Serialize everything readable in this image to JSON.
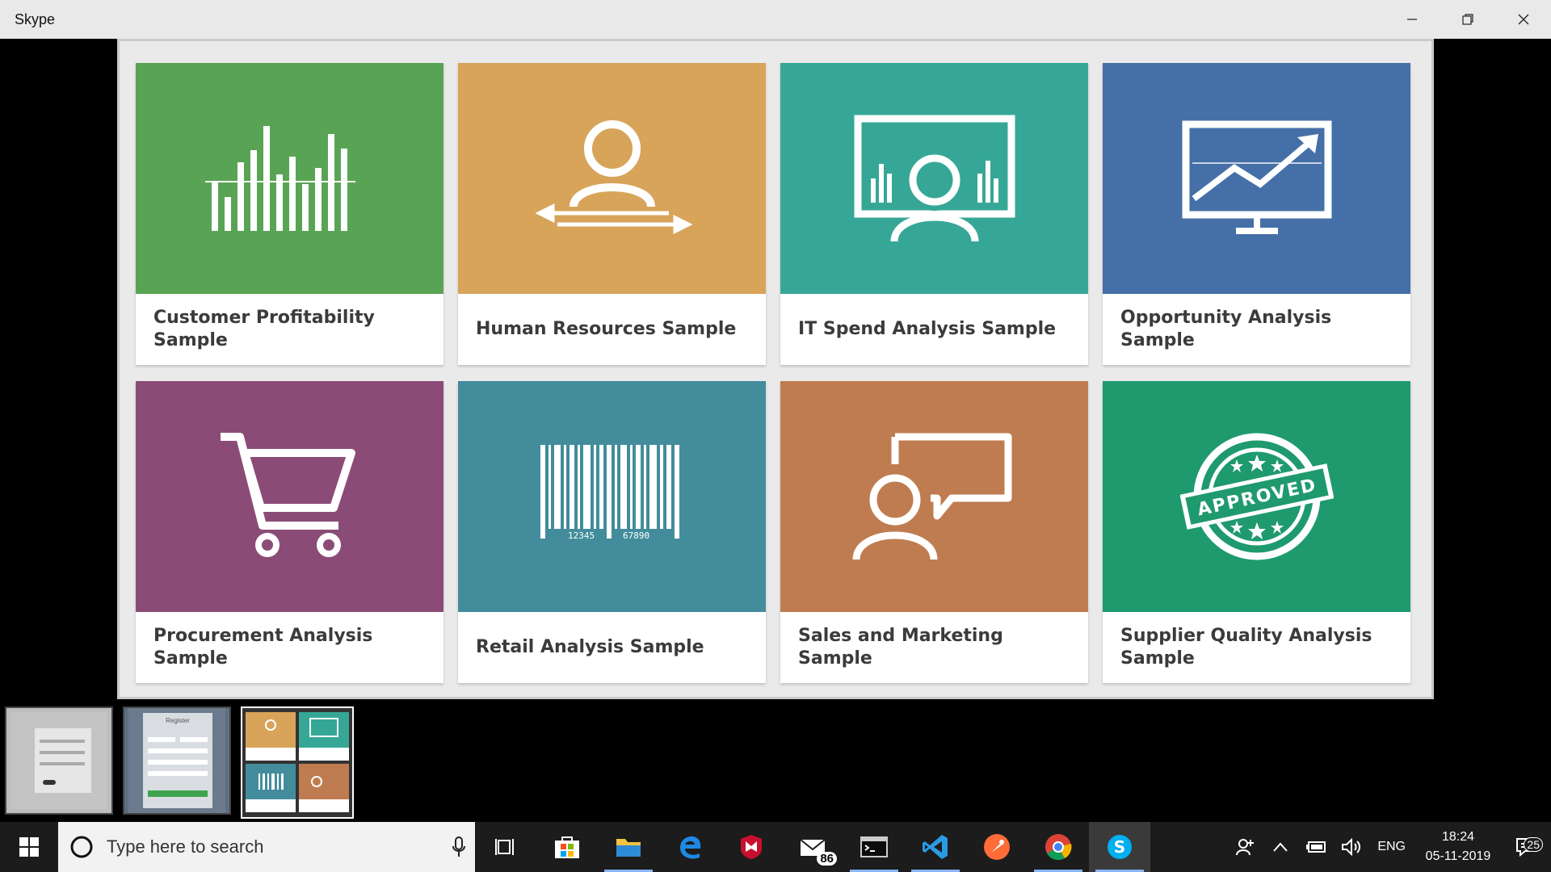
{
  "window": {
    "title": "Skype"
  },
  "tiles": [
    {
      "label_line1": "Customer Profitability",
      "label_line2": "Sample",
      "color": "#59a454",
      "icon": "bar-chart-icon"
    },
    {
      "label_line1": "Human Resources Sample",
      "label_line2": "",
      "color": "#d7a45a",
      "icon": "person-arrows-icon"
    },
    {
      "label_line1": "IT Spend Analysis Sample",
      "label_line2": "",
      "color": "#36a796",
      "icon": "presentation-person-icon"
    },
    {
      "label_line1": "Opportunity Analysis Sample",
      "label_line2": "",
      "color": "#456fa7",
      "icon": "monitor-trend-icon"
    },
    {
      "label_line1": "Procurement Analysis",
      "label_line2": "Sample",
      "color": "#8a4c77",
      "icon": "shopping-cart-icon"
    },
    {
      "label_line1": "Retail Analysis Sample",
      "label_line2": "",
      "color": "#438c9c",
      "icon": "barcode-icon"
    },
    {
      "label_line1": "Sales and Marketing Sample",
      "label_line2": "",
      "color": "#bf7c50",
      "icon": "person-speech-icon"
    },
    {
      "label_line1": "Supplier Quality Analysis",
      "label_line2": "Sample",
      "color": "#1f9a6e",
      "icon": "approved-stamp-icon"
    }
  ],
  "barcode": {
    "digits_left": "12345",
    "digits_right": "67890"
  },
  "stamp": {
    "text": "APPROVED"
  },
  "thumbnails": {
    "register_title": "Register"
  },
  "taskbar": {
    "search_placeholder": "Type here to search",
    "mail_badge": "86",
    "language": "ENG",
    "time": "18:24",
    "date": "05-11-2019",
    "notifications": "25"
  }
}
